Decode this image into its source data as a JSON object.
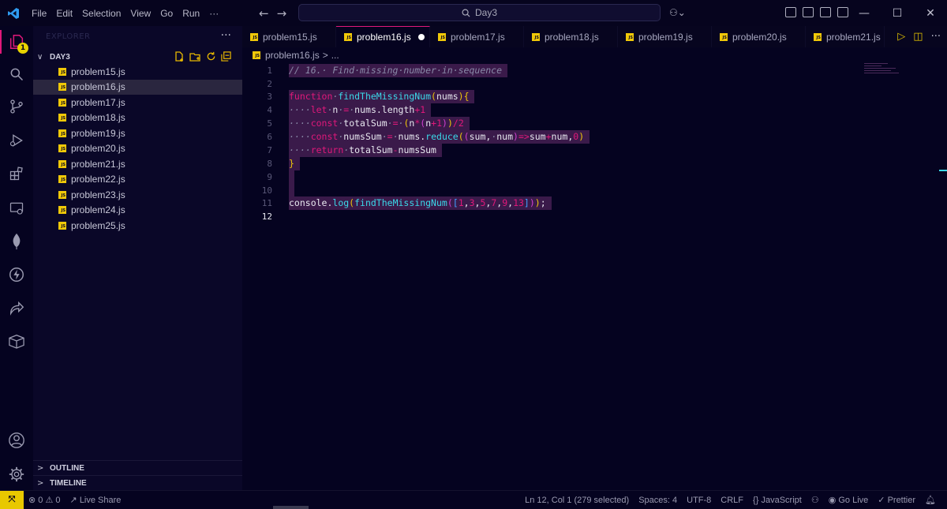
{
  "titlebar": {
    "menu": [
      "File",
      "Edit",
      "Selection",
      "View",
      "Go",
      "Run",
      "···"
    ],
    "search_text": "Day3",
    "icons": [
      "vscode-logo-icon",
      "back-arrow-icon",
      "forward-arrow-icon",
      "search-icon",
      "copilot-icon",
      "layout-icons",
      "minimize-icon",
      "maximize-icon",
      "close-icon"
    ]
  },
  "activitybar": {
    "badge": "1",
    "icons": [
      "explorer-icon",
      "search-icon",
      "source-control-icon",
      "run-debug-icon",
      "extensions-icon",
      "remote-explorer-icon",
      "mongodb-leaf-icon",
      "thunder-client-icon",
      "live-share-icon",
      "package-icon",
      "account-icon",
      "settings-gear-icon"
    ]
  },
  "sidebar": {
    "title": "EXPLORER",
    "more": "···",
    "folder": "DAY3",
    "files": [
      "problem15.js",
      "problem16.js",
      "problem17.js",
      "problem18.js",
      "problem19.js",
      "problem20.js",
      "problem21.js",
      "problem22.js",
      "problem23.js",
      "problem24.js",
      "problem25.js"
    ],
    "selected_file": "problem16.js",
    "outline": "OUTLINE",
    "timeline": "TIMELINE"
  },
  "tabs": [
    "problem15.js",
    "problem16.js",
    "problem17.js",
    "problem18.js",
    "problem19.js",
    "problem20.js",
    "problem21.js"
  ],
  "active_tab": "problem16.js",
  "breadcrumb": {
    "file": "problem16.js",
    "sep": ">",
    "rest": "..."
  },
  "editor": {
    "line_numbers": [
      "1",
      "2",
      "3",
      "4",
      "5",
      "6",
      "7",
      "8",
      "9",
      "10",
      "11",
      "12"
    ],
    "current_line": "12"
  },
  "statusbar": {
    "errors": "0",
    "warnings": "0",
    "live_share": "Live Share",
    "position": "Ln 12, Col 1 (279 selected)",
    "spaces": "Spaces: 4",
    "encoding": "UTF-8",
    "eol": "CRLF",
    "language": "JavaScript",
    "go_live": "Go Live",
    "prettier": "Prettier"
  },
  "colors": {
    "background": "#050320",
    "accent_pink": "#e0187a",
    "accent_yellow": "#f0c808",
    "function_cyan": "#3ad8e8"
  }
}
